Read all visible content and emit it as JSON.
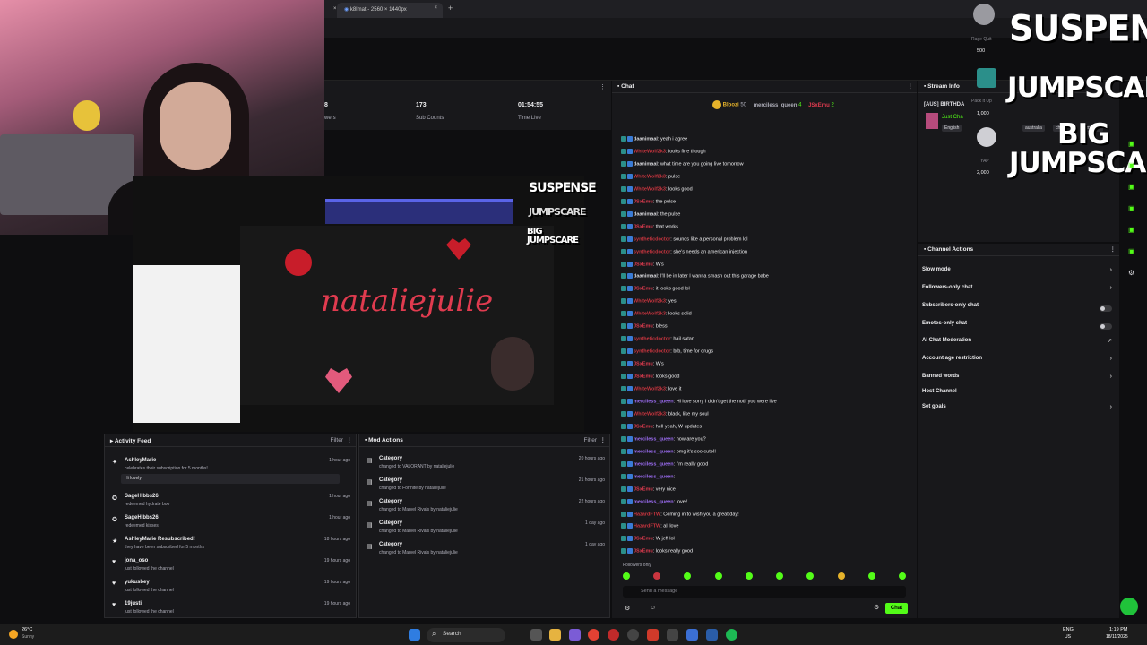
{
  "browser": {
    "tab_label": "k8lmat - 2560 × 1440px",
    "close_glyph": "×",
    "new_tab_glyph": "+"
  },
  "stats": [
    {
      "value": "8",
      "label": "wers"
    },
    {
      "value": "173",
      "label": "Sub Counts"
    },
    {
      "value": "01:54:55",
      "label": "Time Live"
    }
  ],
  "preview": {
    "title_art": "nataliejulie",
    "overlay": [
      "SUSPENSE",
      "JUMPSCARE",
      "BIG JUMPSCARE"
    ]
  },
  "activity_feed": {
    "title": "Activity Feed",
    "filter_label": "Filter",
    "items": [
      {
        "name": "AshleyMarie",
        "sub": "celebrates their subscription for 5 months!",
        "time": "1 hour ago",
        "message": "Hi lovely",
        "icon": "star-icon"
      },
      {
        "name": "SageHibbs26",
        "sub": "redeemed hydrate boo",
        "time": "1 hour ago",
        "icon": "points-icon"
      },
      {
        "name": "SageHibbs26",
        "sub": "redeemed kisses",
        "time": "1 hour ago",
        "icon": "points-icon"
      },
      {
        "name": "AshleyMarie Resubscribed!",
        "sub": "they have been subscribed for 5 months",
        "time": "18 hours ago",
        "icon": "star-icon"
      },
      {
        "name": "jona_oso",
        "sub": "just followed the channel",
        "time": "19 hours ago",
        "icon": "heart-icon"
      },
      {
        "name": "yukusbey",
        "sub": "just followed the channel",
        "time": "19 hours ago",
        "icon": "heart-icon"
      },
      {
        "name": "19justi",
        "sub": "just followed the channel",
        "time": "19 hours ago",
        "icon": "heart-icon"
      }
    ]
  },
  "mod_actions": {
    "title": "Mod Actions",
    "filter_label": "Filter",
    "items": [
      {
        "title": "Category",
        "detail": "changed to VALORANT by nataliejulie",
        "time": "20 hours ago"
      },
      {
        "title": "Category",
        "detail": "changed to Fortnite by nataliejulie",
        "time": "21 hours ago"
      },
      {
        "title": "Category",
        "detail": "changed to Marvel Rivals by nataliejulie",
        "time": "22 hours ago"
      },
      {
        "title": "Category",
        "detail": "changed to Marvel Rivals by nataliejulie",
        "time": "1 day ago"
      },
      {
        "title": "Category",
        "detail": "changed to Marvel Rivals by nataliejulie",
        "time": "1 day ago"
      }
    ]
  },
  "chat": {
    "title": "Chat",
    "top_chatters": [
      {
        "name": "Bloozi",
        "count": "50"
      },
      {
        "name": "merciless_queen",
        "count": "4"
      },
      {
        "name": "JSxEmu",
        "count": "2"
      }
    ],
    "lines": [
      {
        "user": "daanimaal",
        "color": "#d4d4d8",
        "text": ": yeah i agree"
      },
      {
        "user": "WhiteWolf2k3",
        "color": "#c9353f",
        "text": ": looks fine though"
      },
      {
        "user": "daanimaal",
        "color": "#d4d4d8",
        "text": ": what time are you going live tomorrow"
      },
      {
        "user": "WhiteWolf2k3",
        "color": "#c9353f",
        "text": ": pulse"
      },
      {
        "user": "WhiteWolf2k3",
        "color": "#c9353f",
        "text": ": looks good"
      },
      {
        "user": "JSxEmu",
        "color": "#e03b4f",
        "text": ": the pulse"
      },
      {
        "user": "daanimaal",
        "color": "#d4d4d8",
        "text": ": the pulse"
      },
      {
        "user": "JSxEmu",
        "color": "#e03b4f",
        "text": ": that works"
      },
      {
        "user": "syntheticdoctor",
        "color": "#c9353f",
        "text": ": sounds like a personal problem lol"
      },
      {
        "user": "syntheticdoctor",
        "color": "#c9353f",
        "text": ": she's needs an american injection"
      },
      {
        "user": "JSxEmu",
        "color": "#e03b4f",
        "text": ": W's"
      },
      {
        "user": "daanimaal",
        "color": "#d4d4d8",
        "text": ": I'll be in later I wanna smash out this garage babe"
      },
      {
        "user": "JSxEmu",
        "color": "#e03b4f",
        "text": ": it looks good lol"
      },
      {
        "user": "WhiteWolf2k3",
        "color": "#c9353f",
        "text": ": yes"
      },
      {
        "user": "WhiteWolf2k3",
        "color": "#c9353f",
        "text": ": looks solid"
      },
      {
        "user": "JSxEmu",
        "color": "#e03b4f",
        "text": ": bless"
      },
      {
        "user": "syntheticdoctor",
        "color": "#c9353f",
        "text": ": hail satan"
      },
      {
        "user": "syntheticdoctor",
        "color": "#c9353f",
        "text": ": brb, time for drugs"
      },
      {
        "user": "JSxEmu",
        "color": "#e03b4f",
        "text": ": W's"
      },
      {
        "user": "JSxEmu",
        "color": "#e03b4f",
        "text": ": looks good"
      },
      {
        "user": "WhiteWolf2k3",
        "color": "#c9353f",
        "text": ": love it"
      },
      {
        "user": "merciless_queen",
        "color": "#9b6cf2",
        "text": ": Hi love sorry I didn't get the notif you were live"
      },
      {
        "user": "WhiteWolf2k3",
        "color": "#c9353f",
        "text": ": black, like my soul"
      },
      {
        "user": "JSxEmu",
        "color": "#e03b4f",
        "text": ": hell yeah, W updates"
      },
      {
        "user": "merciless_queen",
        "color": "#9b6cf2",
        "text": ": how are you?"
      },
      {
        "user": "merciless_queen",
        "color": "#9b6cf2",
        "text": ": omg it's soo cute!!"
      },
      {
        "user": "merciless_queen",
        "color": "#9b6cf2",
        "text": ": I'm really good"
      },
      {
        "user": "merciless_queen",
        "color": "#9b6cf2",
        "text": ":"
      },
      {
        "user": "JSxEmu",
        "color": "#e03b4f",
        "text": ": very nice"
      },
      {
        "user": "merciless_queen",
        "color": "#9b6cf2",
        "text": ": lovel!"
      },
      {
        "user": "HazardFTW",
        "color": "#c9353f",
        "text": ": Coming in to wish you a great day!"
      },
      {
        "user": "HazardFTW",
        "color": "#c9353f",
        "text": ": all love"
      },
      {
        "user": "JSxEmu",
        "color": "#e03b4f",
        "text": ": W jeff lol"
      },
      {
        "user": "JSxEmu",
        "color": "#e03b4f",
        "text": ": looks really good"
      }
    ],
    "followers_only": "Followers only",
    "input_placeholder": "Send a message",
    "send_label": "Chat"
  },
  "stream_info": {
    "title": "Stream Info",
    "stream_title": "[AUS] BIRTHDA",
    "category": "Just Cha",
    "tags": [
      "English",
      "australia",
      "chat",
      "emergirl"
    ]
  },
  "channel_actions": {
    "title": "Channel Actions",
    "items": [
      {
        "label": "Slow mode",
        "control": "chevron"
      },
      {
        "label": "Followers-only chat",
        "control": "chevron"
      },
      {
        "label": "Subscribers-only chat",
        "control": "toggle"
      },
      {
        "label": "Emotes-only chat",
        "control": "toggle"
      },
      {
        "label": "AI Chat Moderation",
        "control": "link"
      },
      {
        "label": "Account age restriction",
        "control": "chevron"
      },
      {
        "label": "Banned words",
        "control": "chevron"
      },
      {
        "label": "Host Channel",
        "control": "none"
      },
      {
        "label": "Set goals",
        "control": "chevron"
      }
    ]
  },
  "rewards": [
    {
      "label": "Rage Quit",
      "cost": "500"
    },
    {
      "label": "Pack it Up",
      "cost": "1,000"
    },
    {
      "label": "YAP",
      "cost": "2,000"
    }
  ],
  "overlay_words": [
    "SUSPENSE",
    "JUMPSCARE",
    "BIG",
    "JUMPSCARE"
  ],
  "taskbar": {
    "weather_temp": "26°C",
    "weather_desc": "Sunny",
    "search_label": "Search",
    "lang": "ENG",
    "region": "US",
    "time": "1:19 PM",
    "date": "18/11/2025"
  }
}
